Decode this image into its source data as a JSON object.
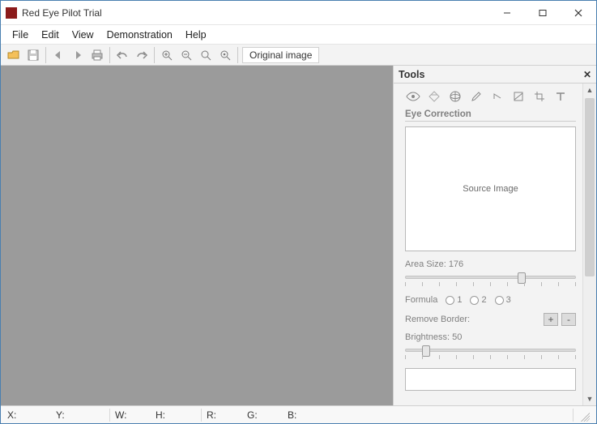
{
  "window": {
    "title": "Red Eye Pilot Trial"
  },
  "menu": {
    "file": "File",
    "edit": "Edit",
    "view": "View",
    "demo": "Demonstration",
    "help": "Help"
  },
  "toolbar": {
    "original": "Original image"
  },
  "tools": {
    "title": "Tools",
    "section": "Eye Correction",
    "preview": "Source Image",
    "area_label": "Area Size:",
    "area_value": "176",
    "formula_label": "Formula",
    "formula_opts": [
      "1",
      "2",
      "3"
    ],
    "remove_border": "Remove Border:",
    "plus": "+",
    "minus": "-",
    "brightness_label": "Brightness:",
    "brightness_value": "50"
  },
  "status": {
    "x": "X:",
    "y": "Y:",
    "w": "W:",
    "h": "H:",
    "r": "R:",
    "g": "G:",
    "b": "B:"
  }
}
